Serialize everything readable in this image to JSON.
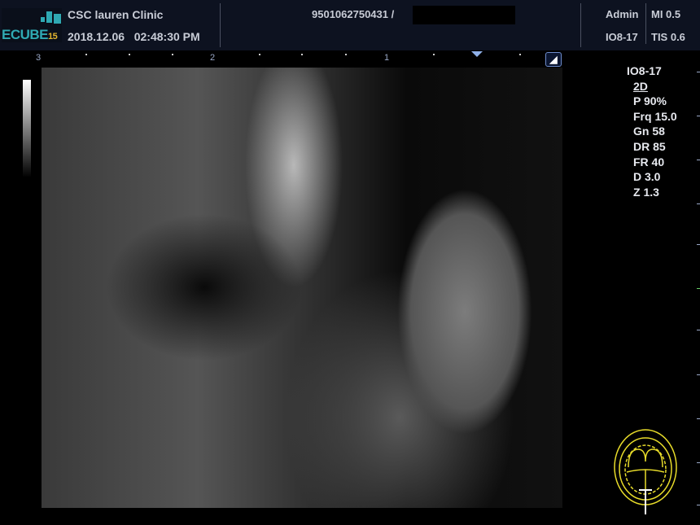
{
  "header": {
    "logo_text": "ECUBE",
    "logo_num": "15",
    "clinic": "CSC lauren Clinic",
    "datetime": "2018.12.06   02:48:30 PM",
    "patient_id": "9501062750431 /",
    "user": "Admin",
    "probe": "IO8-17",
    "mi": "MI 0.5",
    "tis": "TIS 0.6"
  },
  "ruler": {
    "ticks": [
      "3",
      "2",
      "1"
    ]
  },
  "probe_button": "◢",
  "params": {
    "probe": "IO8-17",
    "mode": "2D",
    "power": "P 90%",
    "freq": "Frq 15.0",
    "gain": "Gn 58",
    "dr": "DR 85",
    "fr": "FR 40",
    "depth": "D 3.0",
    "zoom": "Z 1.3"
  },
  "colors": {
    "header_bg": "#0d1220",
    "accent": "#2fa9b3",
    "bodymark": "#e8dc2a"
  }
}
